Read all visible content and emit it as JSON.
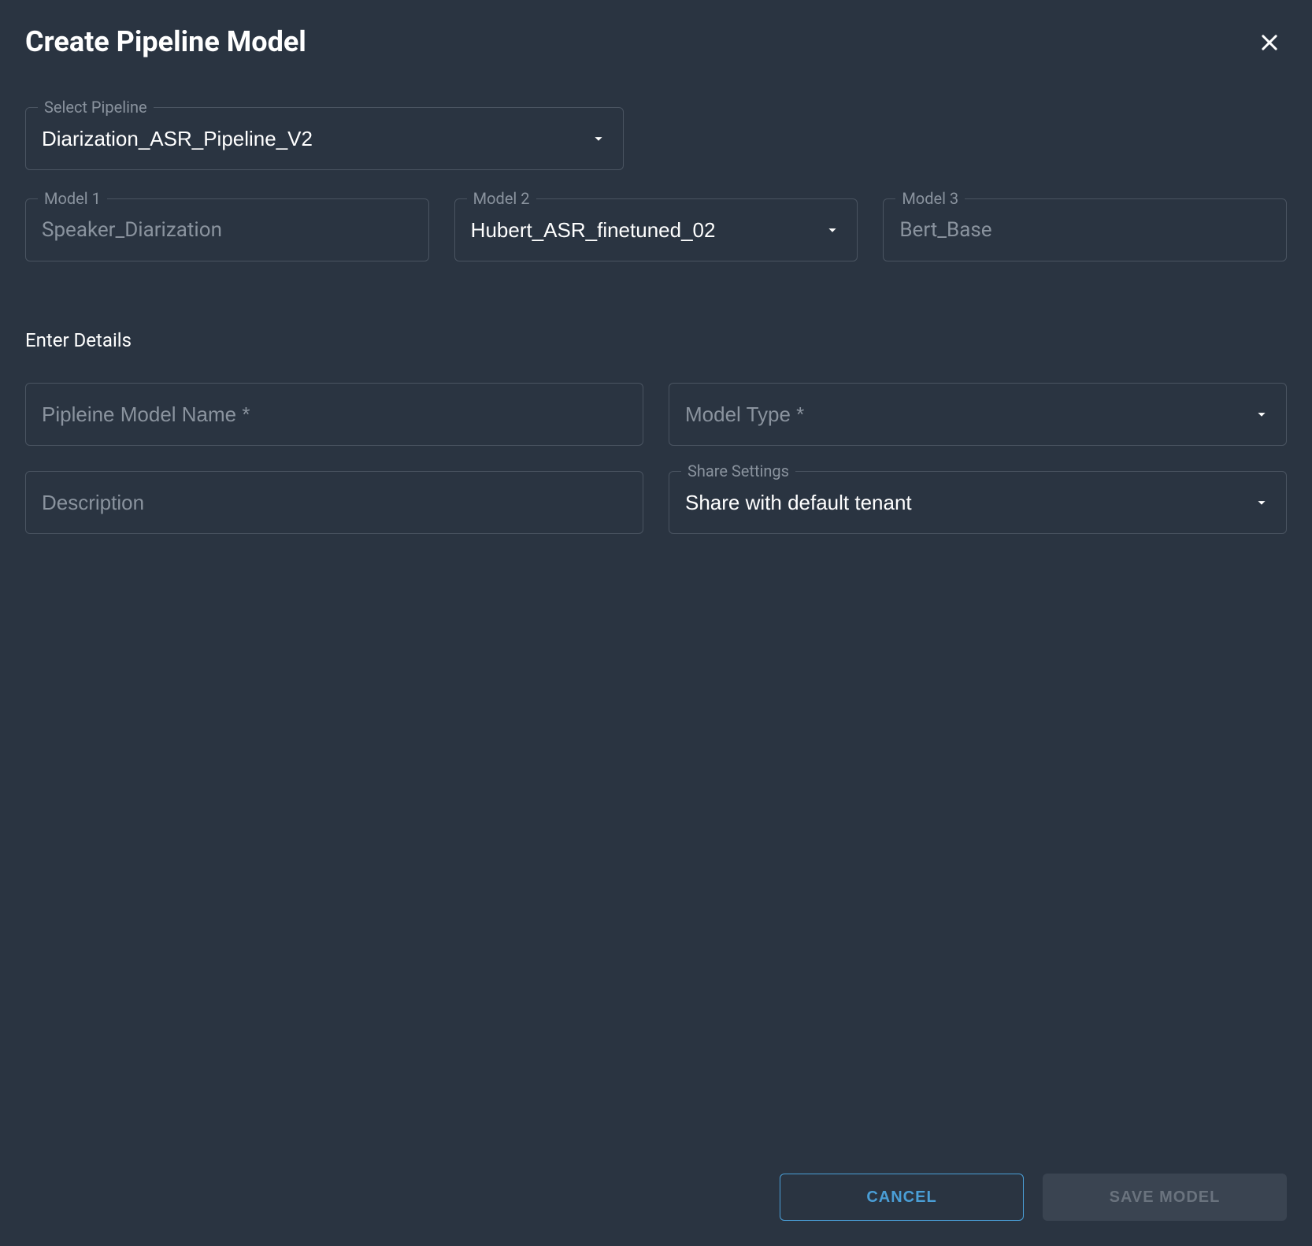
{
  "dialog": {
    "title": "Create Pipeline Model"
  },
  "pipeline": {
    "label": "Select Pipeline",
    "value": "Diarization_ASR_Pipeline_V2"
  },
  "models": {
    "model1": {
      "label": "Model 1",
      "value": "Speaker_Diarization"
    },
    "model2": {
      "label": "Model 2",
      "value": "Hubert_ASR_finetuned_02"
    },
    "model3": {
      "label": "Model 3",
      "value": "Bert_Base"
    }
  },
  "details": {
    "section_title": "Enter Details",
    "model_name": {
      "placeholder": "Pipleine Model Name *"
    },
    "model_type": {
      "placeholder": "Model Type *"
    },
    "description": {
      "placeholder": "Description"
    },
    "share_settings": {
      "label": "Share Settings",
      "value": "Share with default tenant"
    }
  },
  "buttons": {
    "cancel": "CANCEL",
    "save": "SAVE MODEL"
  }
}
